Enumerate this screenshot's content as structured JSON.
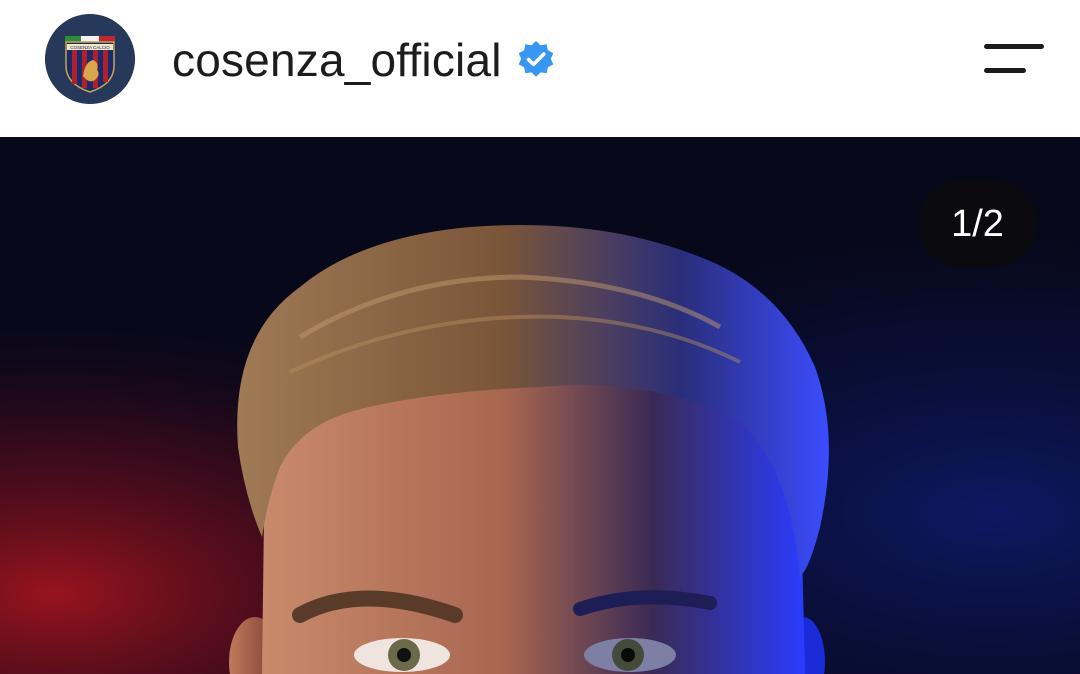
{
  "header": {
    "username": "cosenza_official",
    "verified": true,
    "avatar": {
      "icon": "club-crest-icon",
      "crest_text": "COSENZA CALCIO"
    },
    "menu": {
      "icon": "hamburger-menu-icon"
    }
  },
  "post": {
    "media": {
      "type": "photo",
      "subject": "player-portrait"
    },
    "carousel": {
      "counter": "1/2",
      "current": 1,
      "total": 2
    }
  },
  "colors": {
    "text": "#1c1c1c",
    "verified_badge": "#3897f0",
    "counter_bg": "#0b0b0f",
    "light_red": "#a0141e",
    "light_blue": "#1e3cff",
    "avatar_bg": "#27395a"
  }
}
